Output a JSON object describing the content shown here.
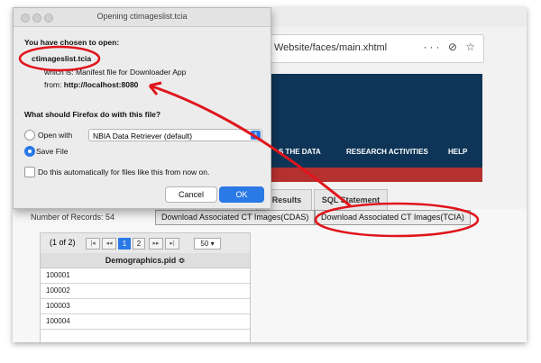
{
  "dialog": {
    "title": "Opening ctimageslist.tcia",
    "chosen_heading": "You have chosen to open:",
    "filename": "ctimageslist.tcia",
    "which_is": "which is: Manifest file for Downloader App",
    "from_label": "from:",
    "from_value": "http://localhost:8080",
    "question": "What should Firefox do with this file?",
    "open_with_label": "Open with",
    "open_with_app": "NBIA Data Retriever (default)",
    "save_file_label": "Save File",
    "auto_label": "Do this automatically for files like this from now on.",
    "cancel_label": "Cancel",
    "ok_label": "OK"
  },
  "browser": {
    "url": "Website/faces/main.xhtml",
    "url_actions": "··· ⊘ ☆",
    "nav_items": [
      "S THE DATA",
      "RESEARCH ACTIVITIES",
      "HELP"
    ]
  },
  "tabs": [
    "r Results",
    "SQL Statement"
  ],
  "results": {
    "records": "Number of Records: 54",
    "download_cdas": "Download Associated CT Images(CDAS)",
    "download_tcia": "Download Associated CT Images(TCIA)"
  },
  "table": {
    "page_info": "(1 of 2)",
    "pages": [
      "1",
      "2"
    ],
    "nav_first": "|◂",
    "nav_prev": "◂◂",
    "nav_next": "▸▸",
    "nav_last": "▸|",
    "rows_per_page": "50",
    "column": "Demographics.pid ≎",
    "rows": [
      "100001",
      "100002",
      "100003",
      "100004"
    ]
  },
  "colors": {
    "annotation_red": "#e0141b",
    "banner_navy": "#0e3557",
    "accent_blue": "#2a79e6"
  }
}
